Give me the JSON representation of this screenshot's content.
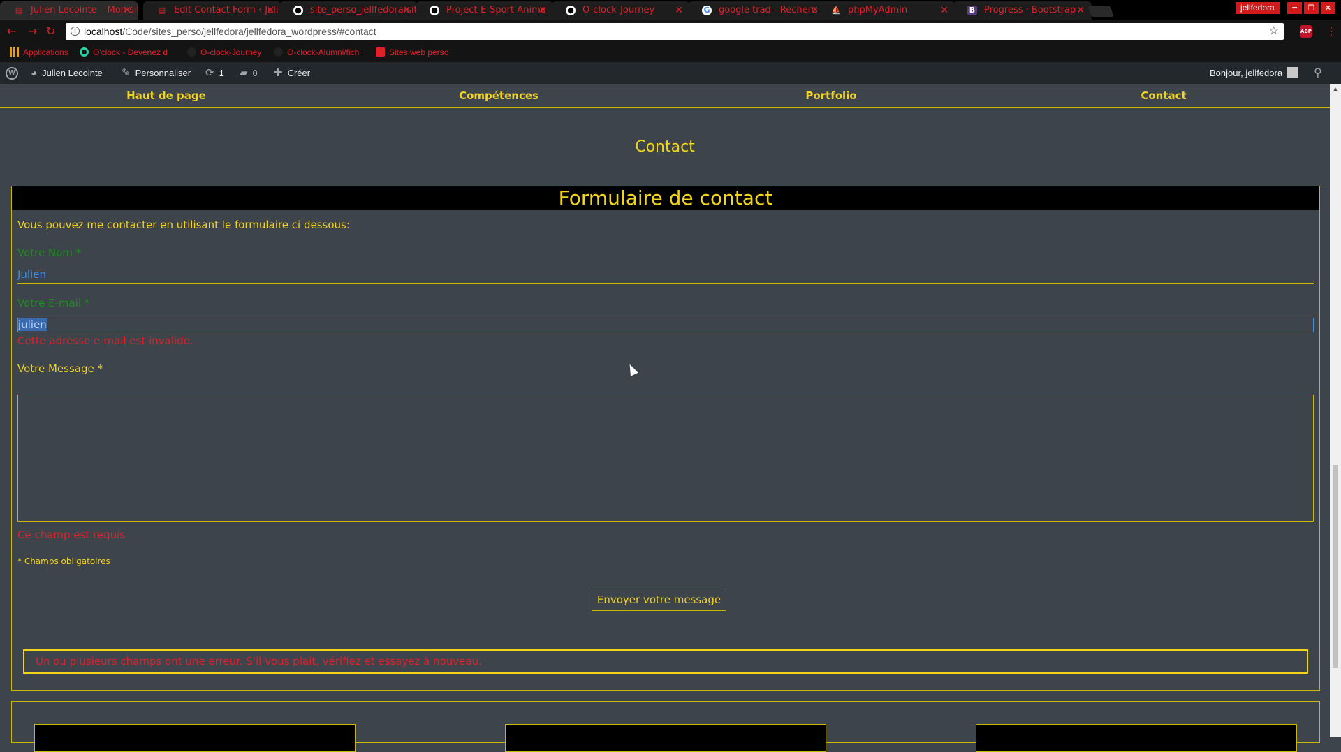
{
  "browser": {
    "tabs": [
      {
        "title": "Julien Lecointe – Mon site",
        "icon": "wordpress-icon",
        "active": true
      },
      {
        "title": "Edit Contact Form ‹ Julie",
        "icon": "page-icon"
      },
      {
        "title": "site_perso_jellfedora/sit",
        "icon": "github-icon"
      },
      {
        "title": "Project-E-Sport-Anime",
        "icon": "github-icon"
      },
      {
        "title": "O-clock-Journey",
        "icon": "github-icon"
      },
      {
        "title": "google trad - Recherche",
        "icon": "google-icon"
      },
      {
        "title": "phpMyAdmin",
        "icon": "phpmyadmin-icon"
      },
      {
        "title": "Progress · Bootstrap",
        "icon": "bootstrap-icon"
      }
    ],
    "profile": "jellfedora",
    "url_host": "localhost",
    "url_path": "/Code/sites_perso/jellfedora/jellfedora_wordpress/#contact",
    "abp_label": "ABP",
    "bookmarks": [
      {
        "label": "Applications",
        "icon": "apps-grid-icon"
      },
      {
        "label": "O'clock - Devenez d",
        "icon": "oclock-icon"
      },
      {
        "label": "O-clock-Journey",
        "icon": "github-icon"
      },
      {
        "label": "O-clock-Alumni/fich",
        "icon": "github-icon"
      },
      {
        "label": "Sites web perso",
        "icon": "folder-icon"
      }
    ]
  },
  "adminbar": {
    "site_name": "Julien Lecointe",
    "customize": "Personnaliser",
    "updates": "1",
    "comments": "0",
    "new": "Créer",
    "greeting": "Bonjour, jellfedora"
  },
  "sitenav": [
    "Haut de page",
    "Compétences",
    "Portfolio",
    "Contact"
  ],
  "page": {
    "section_title": "Contact",
    "form_title": "Formulaire de contact",
    "intro": "Vous pouvez me contacter en utilisant le formulaire ci dessous:",
    "name_label": "Votre Nom *",
    "name_value": "Julien",
    "email_label": "Votre E-mail *",
    "email_value": "julien",
    "email_error": "Cette adresse e-mail est invalide.",
    "message_label": "Votre Message *",
    "message_error": "Ce champ est requis",
    "required_note": "* Champs obligatoires",
    "submit_label": "Envoyer votre message",
    "form_error": "Un ou plusieurs champs ont une erreur. S'il vous plait, vérifiez et essayez à nouveau."
  }
}
